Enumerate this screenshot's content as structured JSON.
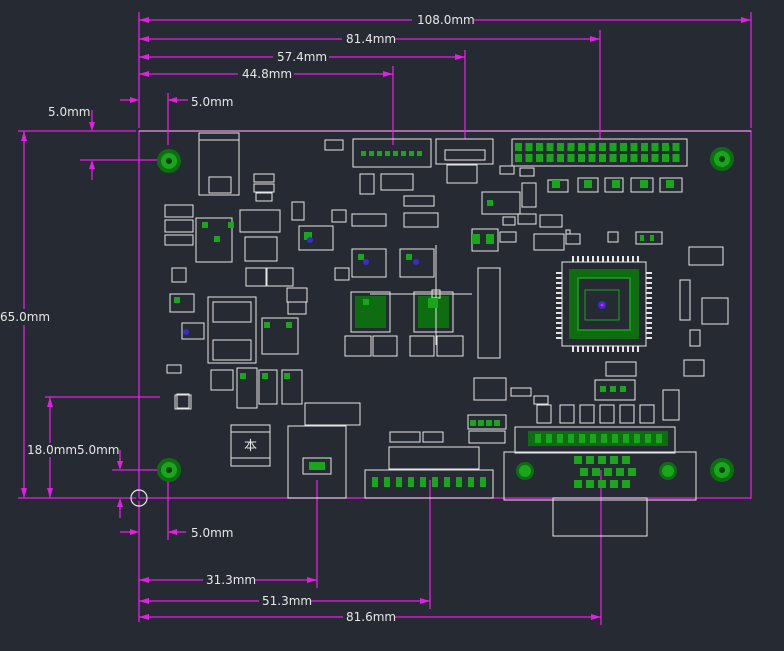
{
  "board": {
    "dimensions": {
      "total_width": "108.0mm",
      "width_2": "81.4mm",
      "width_3": "57.4mm",
      "width_4": "44.8mm",
      "left_offset": "5.0mm",
      "left_hole_x": "5.0mm",
      "height": "65.0mm",
      "lower_height": "18.0mm",
      "lower_offset": "5.0mm",
      "bottom_hole": "5.0mm",
      "bottom_31": "31.3mm",
      "bottom_51": "51.3mm",
      "bottom_81": "81.6mm"
    },
    "chip_marker": "本"
  },
  "colors": {
    "background": "#262b33",
    "dimension": "#e51ee5",
    "outline": "#e6e6e6",
    "pad": "#19a51c"
  }
}
